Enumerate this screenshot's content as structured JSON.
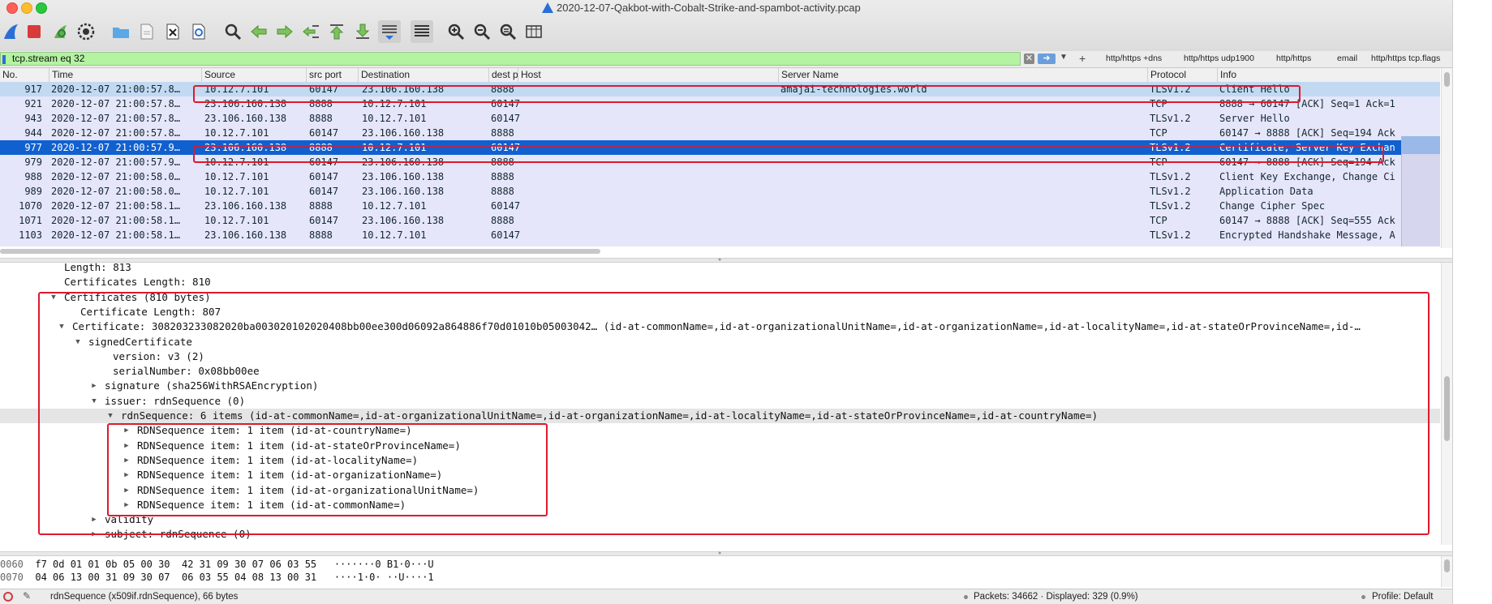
{
  "window": {
    "title": "2020-12-07-Qakbot-with-Cobalt-Strike-and-spambot-activity.pcap"
  },
  "toolbar": {
    "icons": [
      "wireshark-fin-icon",
      "stop-capture-icon",
      "restart-capture-icon",
      "capture-options-icon",
      "open-file-icon",
      "save-file-icon",
      "close-file-icon",
      "reload-file-icon",
      "find-packet-icon",
      "go-back-icon",
      "go-forward-icon",
      "go-to-packet-icon",
      "go-first-icon",
      "go-last-icon",
      "autoscroll-icon",
      "colorize-icon",
      "zoom-in-icon",
      "zoom-out-icon",
      "zoom-normal-icon",
      "resize-columns-icon"
    ]
  },
  "filter": {
    "value": "tcp.stream eq 32",
    "buttons": [
      "http/https +dns",
      "http/https udp1900",
      "http/https",
      "email",
      "http/https tcp.flags"
    ]
  },
  "packet_list": {
    "columns": [
      "No.",
      "Time",
      "Source",
      "src port",
      "Destination",
      "dest port",
      "Host",
      "Server Name",
      "Protocol",
      "Info"
    ],
    "rows": [
      {
        "no": "917",
        "time": "2020-12-07 21:00:57.8…",
        "src": "10.12.7.101",
        "sport": "60147",
        "dst": "23.106.160.138",
        "dport": "8888",
        "host": "",
        "server": "amajai-technologies.world",
        "proto": "TLSv1.2",
        "info": "Client Hello"
      },
      {
        "no": "921",
        "time": "2020-12-07 21:00:57.8…",
        "src": "23.106.160.138",
        "sport": "8888",
        "dst": "10.12.7.101",
        "dport": "60147",
        "host": "",
        "server": "",
        "proto": "TCP",
        "info": "8888 → 60147 [ACK] Seq=1 Ack=1"
      },
      {
        "no": "943",
        "time": "2020-12-07 21:00:57.8…",
        "src": "23.106.160.138",
        "sport": "8888",
        "dst": "10.12.7.101",
        "dport": "60147",
        "host": "",
        "server": "",
        "proto": "TLSv1.2",
        "info": "Server Hello"
      },
      {
        "no": "944",
        "time": "2020-12-07 21:00:57.8…",
        "src": "10.12.7.101",
        "sport": "60147",
        "dst": "23.106.160.138",
        "dport": "8888",
        "host": "",
        "server": "",
        "proto": "TCP",
        "info": "60147 → 8888 [ACK] Seq=194 Ack"
      },
      {
        "no": "977",
        "time": "2020-12-07 21:00:57.9…",
        "src": "23.106.160.138",
        "sport": "8888",
        "dst": "10.12.7.101",
        "dport": "60147",
        "host": "",
        "server": "",
        "proto": "TLSv1.2",
        "info": "Certificate, Server Key Exchan"
      },
      {
        "no": "979",
        "time": "2020-12-07 21:00:57.9…",
        "src": "10.12.7.101",
        "sport": "60147",
        "dst": "23.106.160.138",
        "dport": "8888",
        "host": "",
        "server": "",
        "proto": "TCP",
        "info": "60147 → 8888 [ACK] Seq=194 Ack"
      },
      {
        "no": "988",
        "time": "2020-12-07 21:00:58.0…",
        "src": "10.12.7.101",
        "sport": "60147",
        "dst": "23.106.160.138",
        "dport": "8888",
        "host": "",
        "server": "",
        "proto": "TLSv1.2",
        "info": "Client Key Exchange, Change Ci"
      },
      {
        "no": "989",
        "time": "2020-12-07 21:00:58.0…",
        "src": "10.12.7.101",
        "sport": "60147",
        "dst": "23.106.160.138",
        "dport": "8888",
        "host": "",
        "server": "",
        "proto": "TLSv1.2",
        "info": "Application Data"
      },
      {
        "no": "1070",
        "time": "2020-12-07 21:00:58.1…",
        "src": "23.106.160.138",
        "sport": "8888",
        "dst": "10.12.7.101",
        "dport": "60147",
        "host": "",
        "server": "",
        "proto": "TLSv1.2",
        "info": "Change Cipher Spec"
      },
      {
        "no": "1071",
        "time": "2020-12-07 21:00:58.1…",
        "src": "10.12.7.101",
        "sport": "60147",
        "dst": "23.106.160.138",
        "dport": "8888",
        "host": "",
        "server": "",
        "proto": "TCP",
        "info": "60147 → 8888 [ACK] Seq=555 Ack"
      },
      {
        "no": "1103",
        "time": "2020-12-07 21:00:58.1…",
        "src": "23.106.160.138",
        "sport": "8888",
        "dst": "10.12.7.101",
        "dport": "60147",
        "host": "",
        "server": "",
        "proto": "TLSv1.2",
        "info": "Encrypted Handshake Message, A"
      }
    ]
  },
  "details": {
    "rows": [
      {
        "indent": 0,
        "tri": "",
        "text": "Length: 813"
      },
      {
        "indent": 0,
        "tri": "",
        "text": "Certificates Length: 810"
      },
      {
        "indent": 0,
        "tri": "▼",
        "text": "Certificates (810 bytes)"
      },
      {
        "indent": 1,
        "tri": "",
        "text": "Certificate Length: 807"
      },
      {
        "indent": 0.5,
        "tri": "▼",
        "text": "Certificate: 308203233082020ba003020102020408bb00ee300d06092a864886f70d01010b05003042… (id-at-commonName=,id-at-organizationalUnitName=,id-at-organizationName=,id-at-localityName=,id-at-stateOrProvinceName=,id-…"
      },
      {
        "indent": 1.5,
        "tri": "▼",
        "text": "signedCertificate"
      },
      {
        "indent": 3,
        "tri": "",
        "text": "version: v3 (2)"
      },
      {
        "indent": 3,
        "tri": "",
        "text": "serialNumber: 0x08bb00ee"
      },
      {
        "indent": 2.5,
        "tri": "▶",
        "text": "signature (sha256WithRSAEncryption)"
      },
      {
        "indent": 2.5,
        "tri": "▼",
        "text": "issuer: rdnSequence (0)"
      },
      {
        "indent": 3.5,
        "tri": "▼",
        "text": "rdnSequence: 6 items (id-at-commonName=,id-at-organizationalUnitName=,id-at-organizationName=,id-at-localityName=,id-at-stateOrProvinceName=,id-at-countryName=)"
      },
      {
        "indent": 4.5,
        "tri": "▶",
        "text": "RDNSequence item: 1 item (id-at-countryName=)"
      },
      {
        "indent": 4.5,
        "tri": "▶",
        "text": "RDNSequence item: 1 item (id-at-stateOrProvinceName=)"
      },
      {
        "indent": 4.5,
        "tri": "▶",
        "text": "RDNSequence item: 1 item (id-at-localityName=)"
      },
      {
        "indent": 4.5,
        "tri": "▶",
        "text": "RDNSequence item: 1 item (id-at-organizationName=)"
      },
      {
        "indent": 4.5,
        "tri": "▶",
        "text": "RDNSequence item: 1 item (id-at-organizationalUnitName=)"
      },
      {
        "indent": 4.5,
        "tri": "▶",
        "text": "RDNSequence item: 1 item (id-at-commonName=)"
      },
      {
        "indent": 2.5,
        "tri": "▶",
        "text": "validity"
      },
      {
        "indent": 2.5,
        "tri": "▶",
        "text": "subject: rdnSequence (0)"
      }
    ]
  },
  "bytes": {
    "rows": [
      {
        "offset": "0060",
        "hex": "f7 0d 01 01 0b 05 00 30  42 31 09 30 07 06 03 55",
        "ascii": "·······0 B1·0···U"
      },
      {
        "offset": "0070",
        "hex": "04 06 13 00 31 09 30 07  06 03 55 04 08 13 00 31",
        "ascii": "····1·0· ··U····1"
      }
    ]
  },
  "status": {
    "field_info": "rdnSequence (x509if.rdnSequence), 66 bytes",
    "packets": "Packets: 34662 · Displayed: 329 (0.9%)",
    "profile": "Profile: Default"
  },
  "colors": {
    "filter_valid": "#b4f3a2",
    "row_bg": "#e6e6fa",
    "row_selected": "#1160cf",
    "row_related": "#c2d9f2",
    "annotation": "#dd1a2e"
  }
}
